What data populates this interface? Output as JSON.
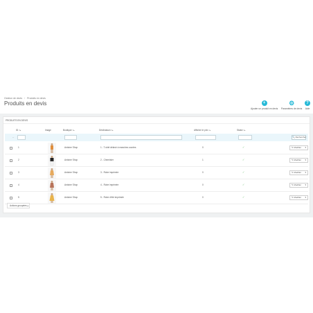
{
  "breadcrumb": [
    "Gestion de devis",
    "Produits en devis"
  ],
  "page_title": "Produits en devis",
  "toolbar": {
    "add_label": "Ajouter un produit en devis",
    "settings_label": "Paramètres de devis",
    "help_label": "Aide",
    "add_icon": "plus-circle-icon",
    "settings_icon": "gears-icon",
    "help_icon": "question-circle-icon"
  },
  "panel": {
    "heading": "PRODUITS EN DEVIS"
  },
  "table": {
    "headers": [
      "ID",
      "Image",
      "Boutique",
      "Déclinaison",
      "Afficher le prix",
      "Statut"
    ],
    "search_label": "Rechercher",
    "filter_dash": "--",
    "edit_label": "Modifier",
    "bulk_label": "Actions groupées",
    "rows": [
      {
        "id": "1",
        "shop": "Antoine Shop",
        "product": "1 - T-shirt délavé à manches courtes",
        "price": "0"
      },
      {
        "id": "2",
        "shop": "Antoine Shop",
        "product": "2 - Chemisier",
        "price": "1"
      },
      {
        "id": "3",
        "shop": "Antoine Shop",
        "product": "3 - Robe imprimée",
        "price": "0"
      },
      {
        "id": "4",
        "shop": "Antoine Shop",
        "product": "4 - Robe imprimée",
        "price": "0"
      },
      {
        "id": "5",
        "shop": "Antoine Shop",
        "product": "5 - Robe d'été imprimée",
        "price": "0"
      }
    ]
  },
  "colors": {
    "accent": "#25b9d7",
    "check": "#72c279",
    "filter_bg": "#eaf6fb"
  }
}
